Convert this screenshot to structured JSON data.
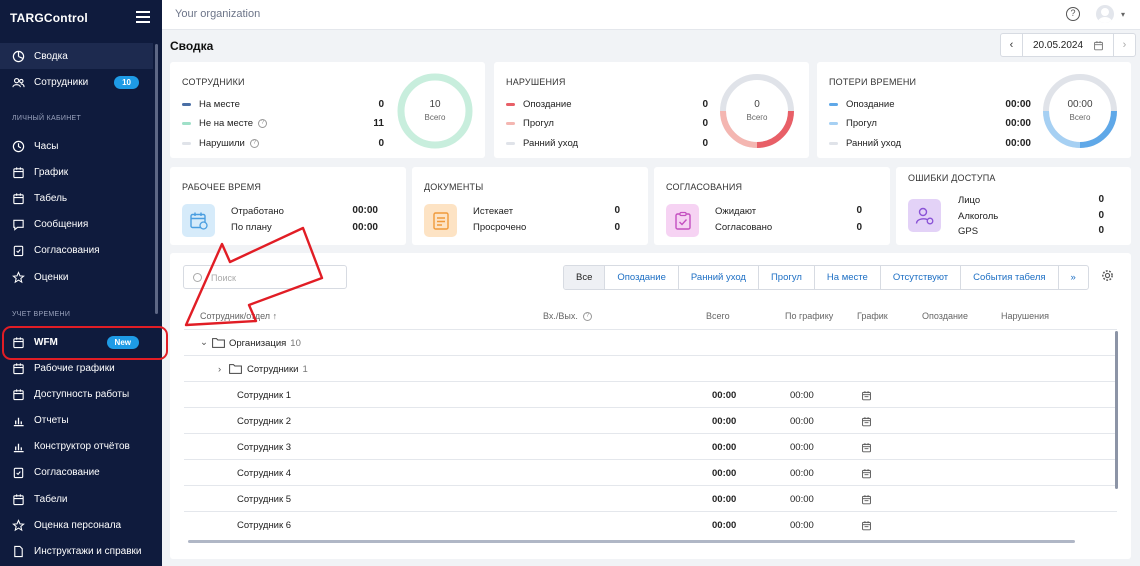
{
  "app": {
    "brand": "TARGControl"
  },
  "topbar": {
    "org": "Your organization",
    "help": "?"
  },
  "page": {
    "title": "Сводка"
  },
  "date": {
    "value": "20.05.2024",
    "prev": "‹",
    "next": "›"
  },
  "sidebar": {
    "top_items": [
      {
        "label": "Сводка",
        "icon": "dashboard-icon"
      },
      {
        "label": "Сотрудники",
        "icon": "users-icon",
        "badge": "10"
      }
    ],
    "section_personal": "ЛИЧНЫЙ КАБИНЕТ",
    "personal_items": [
      {
        "label": "Часы",
        "icon": "clock-icon"
      },
      {
        "label": "График",
        "icon": "calendar-icon"
      },
      {
        "label": "Табель",
        "icon": "calendar-icon"
      },
      {
        "label": "Сообщения",
        "icon": "message-icon"
      },
      {
        "label": "Согласования",
        "icon": "clipboard-icon"
      },
      {
        "label": "Оценки",
        "icon": "star-icon"
      }
    ],
    "section_time": "УЧЕТ ВРЕМЕНИ",
    "time_items": [
      {
        "label": "WFM",
        "icon": "calendar-icon",
        "badge": "New"
      },
      {
        "label": "Рабочие графики",
        "icon": "calendar-icon"
      },
      {
        "label": "Доступность работы",
        "icon": "calendar-icon"
      },
      {
        "label": "Отчеты",
        "icon": "chart-icon"
      },
      {
        "label": "Конструктор отчётов",
        "icon": "chart-icon"
      },
      {
        "label": "Согласование",
        "icon": "clipboard-icon"
      },
      {
        "label": "Табели",
        "icon": "calendar-icon"
      },
      {
        "label": "Оценка персонала",
        "icon": "star-icon"
      },
      {
        "label": "Инструктажи и справки",
        "icon": "document-icon"
      }
    ]
  },
  "cards": {
    "employees": {
      "title": "СОТРУДНИКИ",
      "rows": [
        {
          "label": "На месте",
          "value": "0",
          "color": "#4a6fa5"
        },
        {
          "label": "Не на месте",
          "value": "11",
          "color": "#9fe0c8"
        },
        {
          "label": "Нарушили",
          "value": "0",
          "color": "#e0e3e9"
        }
      ],
      "donut_value": "10",
      "donut_label": "Всего"
    },
    "violations": {
      "title": "НАРУШЕНИЯ",
      "rows": [
        {
          "label": "Опоздание",
          "value": "0",
          "color": "#e85f67"
        },
        {
          "label": "Прогул",
          "value": "0",
          "color": "#f4b6b1"
        },
        {
          "label": "Ранний уход",
          "value": "0",
          "color": "#e0e3e9"
        }
      ],
      "donut_value": "0",
      "donut_label": "Всего"
    },
    "timeloss": {
      "title": "ПОТЕРИ ВРЕМЕНИ",
      "rows": [
        {
          "label": "Опоздание",
          "value": "00:00",
          "color": "#5fa8e8"
        },
        {
          "label": "Прогул",
          "value": "00:00",
          "color": "#a6d0f3"
        },
        {
          "label": "Ранний уход",
          "value": "00:00",
          "color": "#e0e3e9"
        }
      ],
      "donut_value": "00:00",
      "donut_label": "Всего"
    },
    "worktime": {
      "title": "РАБОЧЕЕ ВРЕМЯ",
      "rows": [
        {
          "label": "Отработано",
          "value": "00:00"
        },
        {
          "label": "По плану",
          "value": "00:00"
        }
      ]
    },
    "documents": {
      "title": "ДОКУМЕНТЫ",
      "rows": [
        {
          "label": "Истекает",
          "value": "0"
        },
        {
          "label": "Просрочено",
          "value": "0"
        }
      ]
    },
    "approvals": {
      "title": "СОГЛАСОВАНИЯ",
      "rows": [
        {
          "label": "Ожидают",
          "value": "0"
        },
        {
          "label": "Согласовано",
          "value": "0"
        }
      ]
    },
    "access_errors": {
      "title": "ОШИБКИ ДОСТУПА",
      "rows": [
        {
          "label": "Лицо",
          "value": "0"
        },
        {
          "label": "Алкоголь",
          "value": "0"
        },
        {
          "label": "GPS",
          "value": "0"
        }
      ]
    }
  },
  "table": {
    "search_placeholder": "Поиск",
    "filters": [
      "Все",
      "Опоздание",
      "Ранний уход",
      "Прогул",
      "На месте",
      "Отсутствуют",
      "События табеля",
      "»"
    ],
    "columns": [
      "Сотрудник/отдел ↑",
      "Вх./Вых.",
      "Всего",
      "По графику",
      "График",
      "Опоздание",
      "Нарушения"
    ],
    "org": {
      "name": "Организация",
      "count": "10"
    },
    "group": {
      "name": "Сотрудники",
      "count": "1"
    },
    "rows": [
      {
        "name": "Сотрудник 1",
        "total": "00:00",
        "plan": "00:00"
      },
      {
        "name": "Сотрудник 2",
        "total": "00:00",
        "plan": "00:00"
      },
      {
        "name": "Сотрудник 3",
        "total": "00:00",
        "plan": "00:00"
      },
      {
        "name": "Сотрудник 4",
        "total": "00:00",
        "plan": "00:00"
      },
      {
        "name": "Сотрудник 5",
        "total": "00:00",
        "plan": "00:00"
      },
      {
        "name": "Сотрудник 6",
        "total": "00:00",
        "plan": "00:00"
      }
    ]
  },
  "colors": {
    "sidebar_bg": "#0f1b3d",
    "accent": "#1e9be6",
    "annotation": "#e11d25"
  }
}
